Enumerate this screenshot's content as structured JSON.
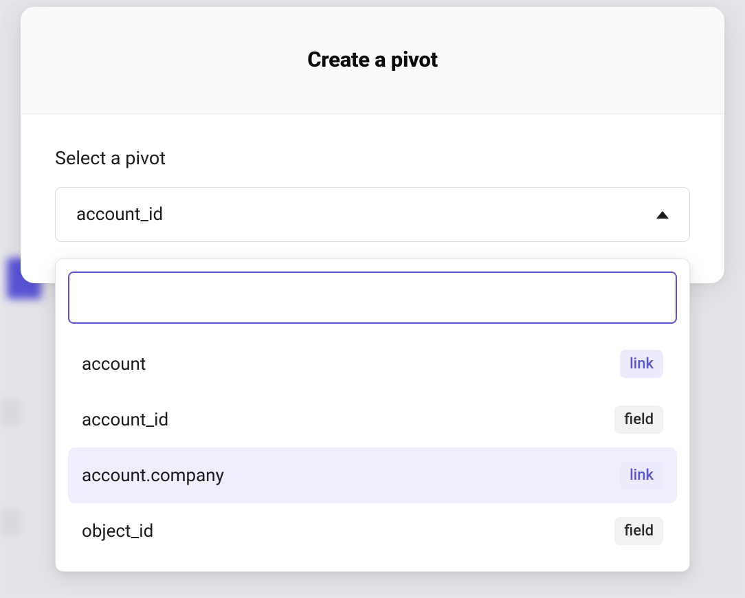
{
  "modal": {
    "title": "Create a pivot",
    "field_label": "Select a pivot",
    "selected_value": "account_id"
  },
  "dropdown": {
    "search_value": "",
    "options": [
      {
        "label": "account",
        "badge_text": "link",
        "badge_type": "link",
        "highlighted": false
      },
      {
        "label": "account_id",
        "badge_text": "field",
        "badge_type": "field",
        "highlighted": false
      },
      {
        "label": "account.company",
        "badge_text": "link",
        "badge_type": "link",
        "highlighted": true
      },
      {
        "label": "object_id",
        "badge_text": "field",
        "badge_type": "field",
        "highlighted": false
      }
    ]
  }
}
